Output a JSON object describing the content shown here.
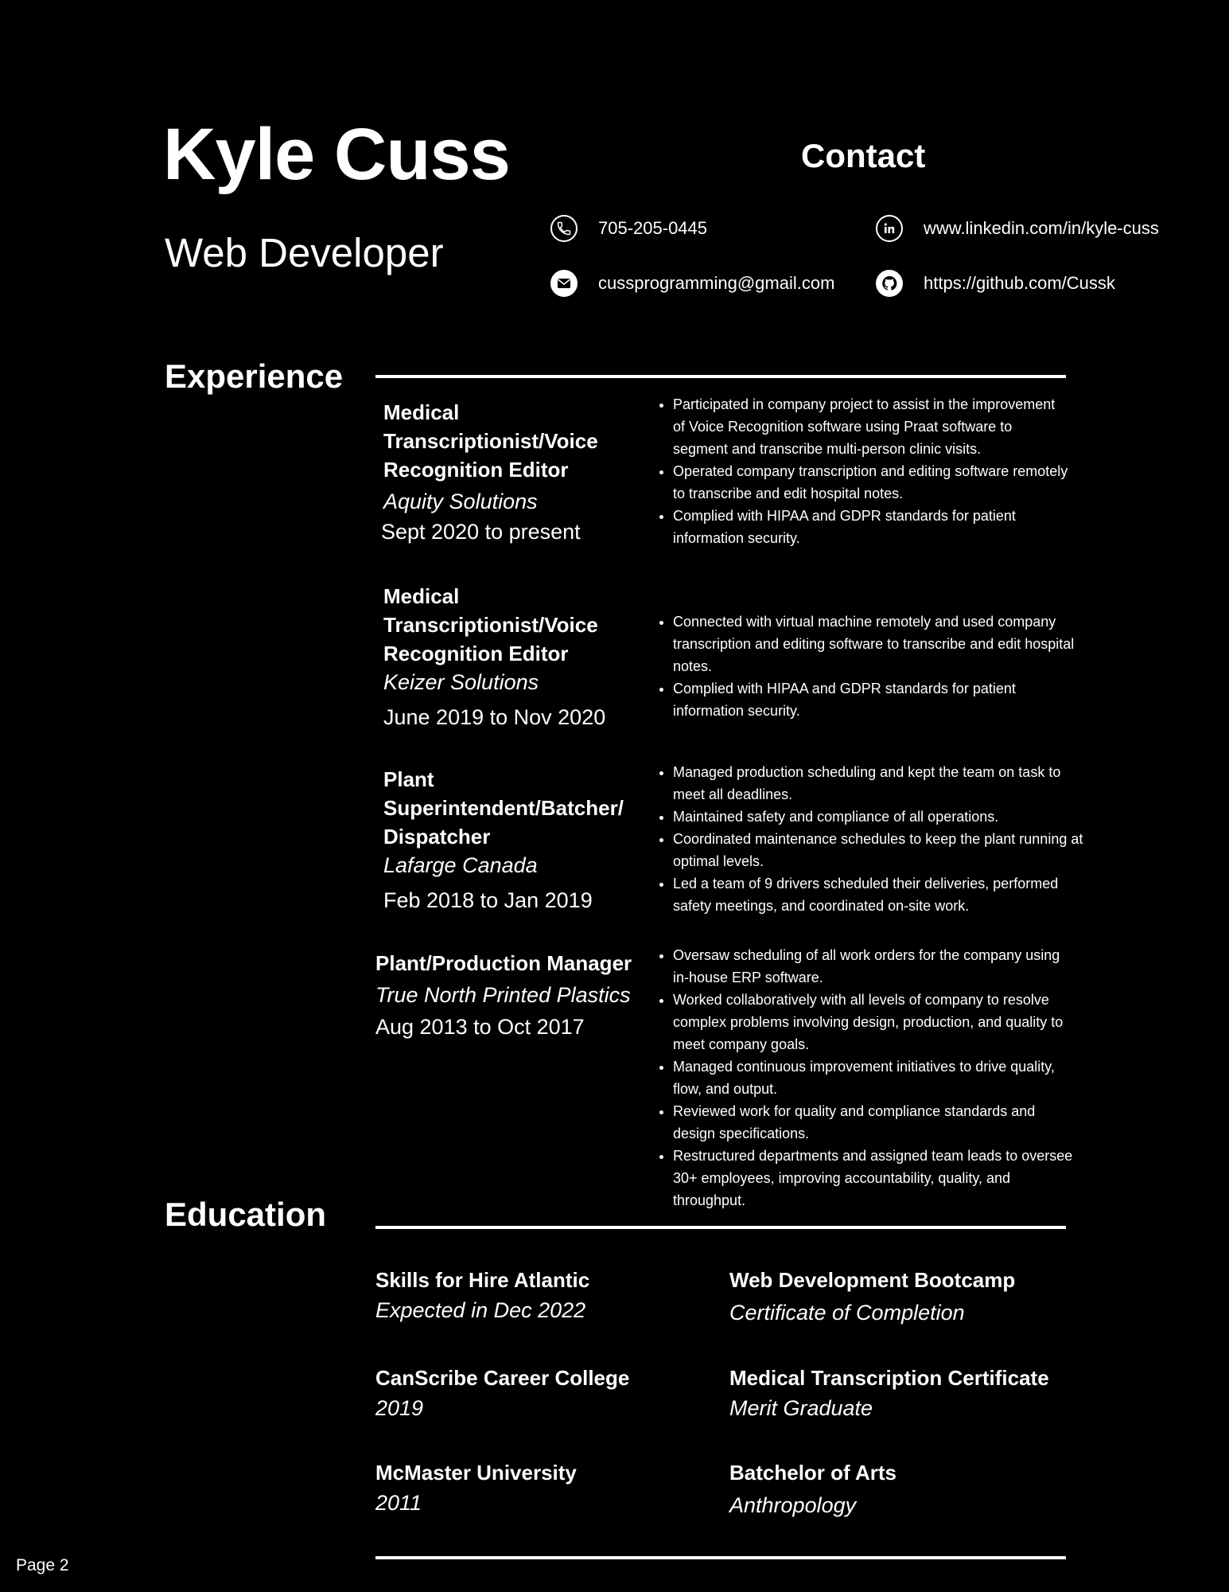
{
  "header": {
    "name": "Kyle Cuss",
    "role": "Web Developer",
    "contact_title": "Contact"
  },
  "contact": {
    "phone": "705-205-0445",
    "email": "cussprogramming@gmail.com",
    "linkedin": "www.linkedin.com/in/kyle-cuss",
    "github": "https://github.com/Cussk",
    "icons": [
      "phone-icon",
      "email-icon",
      "linkedin-icon",
      "github-icon"
    ]
  },
  "experience": {
    "title": "Experience",
    "jobs": [
      {
        "title": "Medical Transcriptionist/Voice Recognition Editor",
        "company": "Aquity Solutions",
        "dates": "Sept 2020 to present",
        "bullets": [
          "Participated in company project to assist in the improvement of Voice Recognition software using Praat software to segment and transcribe multi-person clinic visits.",
          "Operated company transcription and editing software remotely to transcribe and edit hospital notes.",
          "Complied with HIPAA and GDPR standards for patient information security."
        ]
      },
      {
        "title": "Medical Transcriptionist/Voice Recognition Editor",
        "company": "Keizer Solutions",
        "dates": "June 2019 to Nov 2020",
        "bullets": [
          "Connected with virtual machine remotely and used company transcription and editing software to transcribe and edit hospital notes.",
          "Complied with HIPAA and GDPR standards for patient information security."
        ]
      },
      {
        "title": "Plant Superintendent/Batcher/ Dispatcher",
        "company": "Lafarge Canada",
        "dates": "Feb 2018 to Jan 2019",
        "bullets": [
          "Managed production scheduling and kept the team on task to meet all deadlines.",
          " Maintained safety and compliance of all operations.",
          "Coordinated maintenance schedules to keep the plant running at optimal levels.",
          "Led a team of 9 drivers scheduled their deliveries, performed safety meetings, and coordinated on-site work."
        ]
      },
      {
        "title": "Plant/Production Manager",
        "company": "True North Printed Plastics",
        "dates": "Aug 2013 to Oct 2017",
        "bullets": [
          "Oversaw scheduling of all work orders for the company using in-house ERP software.",
          "Worked collaboratively with all levels of company to resolve complex problems involving design, production, and quality to meet company goals.",
          "Managed continuous improvement initiatives to drive quality, flow, and output.",
          "Reviewed work for quality and compliance standards and design specifications.",
          "Restructured departments and assigned team leads to oversee 30+ employees, improving accountability, quality, and throughput."
        ]
      }
    ]
  },
  "education": {
    "title": "Education",
    "items": [
      {
        "title": "Skills for Hire Atlantic",
        "sub": "Expected in Dec 2022"
      },
      {
        "title": "Web Development Bootcamp",
        "sub": "Certificate of Completion"
      },
      {
        "title": "CanScribe Career College",
        "sub": "2019"
      },
      {
        "title": "Medical Transcription Certificate",
        "sub": "Merit Graduate"
      },
      {
        "title": "McMaster University",
        "sub": "2011"
      },
      {
        "title": "Batchelor of Arts",
        "sub": "Anthropology"
      }
    ]
  },
  "footer": {
    "page": "Page 2"
  }
}
